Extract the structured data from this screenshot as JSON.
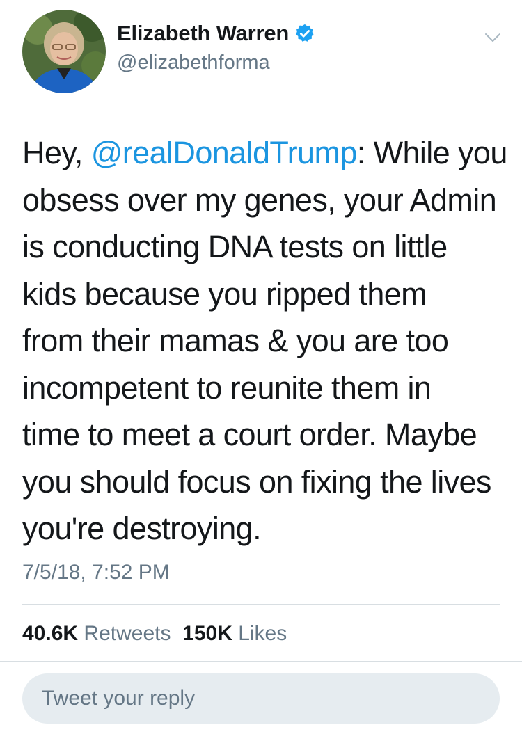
{
  "author": {
    "display_name": "Elizabeth Warren",
    "handle": "@elizabethforma",
    "verified": true
  },
  "tweet": {
    "lines": [
      [
        {
          "text": "Hey, ",
          "mention": false
        },
        {
          "text": "@realDonaldTrump",
          "mention": true
        },
        {
          "text": ": While you",
          "mention": false
        }
      ],
      [
        {
          "text": "obsess over my genes, your Admin",
          "mention": false
        }
      ],
      [
        {
          "text": "is conducting DNA tests on little",
          "mention": false
        }
      ],
      [
        {
          "text": "kids because you ripped them",
          "mention": false
        }
      ],
      [
        {
          "text": "from their mamas & you are too",
          "mention": false
        }
      ],
      [
        {
          "text": "incompetent to reunite them in",
          "mention": false
        }
      ],
      [
        {
          "text": "time to meet a court order. Maybe",
          "mention": false
        }
      ],
      [
        {
          "text": "you should focus on fixing the lives",
          "mention": false
        }
      ],
      [
        {
          "text": "you're destroying.",
          "mention": false
        }
      ]
    ],
    "timestamp": "7/5/18, 7:52 PM"
  },
  "stats": {
    "retweets_count": "40.6K",
    "retweets_label": "Retweets",
    "likes_count": "150K",
    "likes_label": "Likes"
  },
  "reply": {
    "placeholder": "Tweet your reply"
  },
  "icons": {
    "verified": "verified-badge-icon",
    "more": "chevron-down-icon"
  },
  "colors": {
    "mention": "#1b95e0",
    "verified": "#1da1f2",
    "secondary_text": "#657786",
    "reply_background": "#e6ecf0"
  }
}
